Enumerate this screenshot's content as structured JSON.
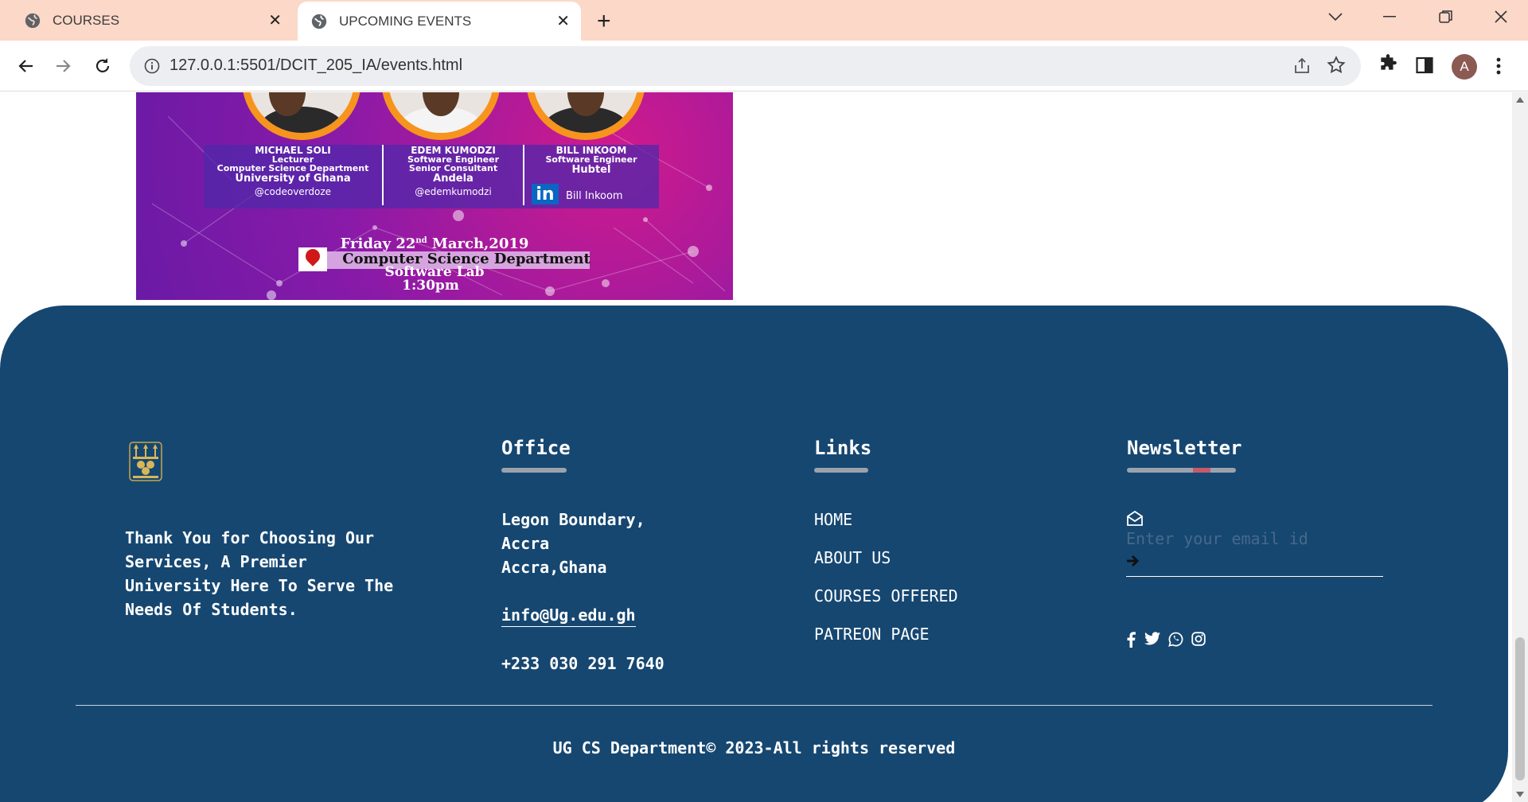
{
  "browser": {
    "tabs": [
      {
        "label": "COURSES",
        "active": false
      },
      {
        "label": "UPCOMING EVENTS",
        "active": true
      }
    ],
    "url": "127.0.0.1:5501/DCIT_205_IA/events.html",
    "profile_initial": "A"
  },
  "poster": {
    "speakers": [
      {
        "name": "MICHAEL SOLI",
        "role": "Lecturer",
        "dept": "Computer Science Department",
        "org": "University of Ghana",
        "handle": "@codeoverdoze"
      },
      {
        "name": "EDEM KUMODZI",
        "role": "Software Engineer",
        "dept": "Senior Consultant",
        "org": "Andela",
        "handle": "@edemkumodzi"
      },
      {
        "name": "BILL INKOOM",
        "role": "Software Engineer",
        "dept": "",
        "org": "Hubtel",
        "handle": "Bill Inkoom"
      }
    ],
    "date_prefix": "Friday 22",
    "date_sup": "nd",
    "date_suffix": " March,2019",
    "venue": "Computer Science Department",
    "room": "Software Lab",
    "time": "1:30pm",
    "linkedin_glyph": "in"
  },
  "footer": {
    "tagline": "Thank You for Choosing Our Services, A Premier University Here To Serve The Needs Of Students.",
    "office": {
      "title": "Office",
      "address_line1": "Legon Boundary,",
      "address_line2": "Accra",
      "address_line3": "Accra,Ghana",
      "email": "info@Ug.edu.gh",
      "phone": "+233 030 291 7640"
    },
    "links": {
      "title": "Links",
      "items": [
        "HOME",
        "ABOUT US",
        "COURSES OFFERED",
        "PATREON PAGE"
      ]
    },
    "newsletter": {
      "title": "Newsletter",
      "placeholder": "Enter your email id",
      "social_icons": [
        "facebook-icon",
        "twitter-icon",
        "whatsapp-icon",
        "instagram-icon"
      ]
    },
    "copyright": "UG CS Department© 2023-All rights reserved"
  },
  "colors": {
    "tabbar": "#fcd8c8",
    "footer_bg": "#164771",
    "poster_orange": "#f7941d",
    "poster_magenta": "#d01a8c"
  }
}
